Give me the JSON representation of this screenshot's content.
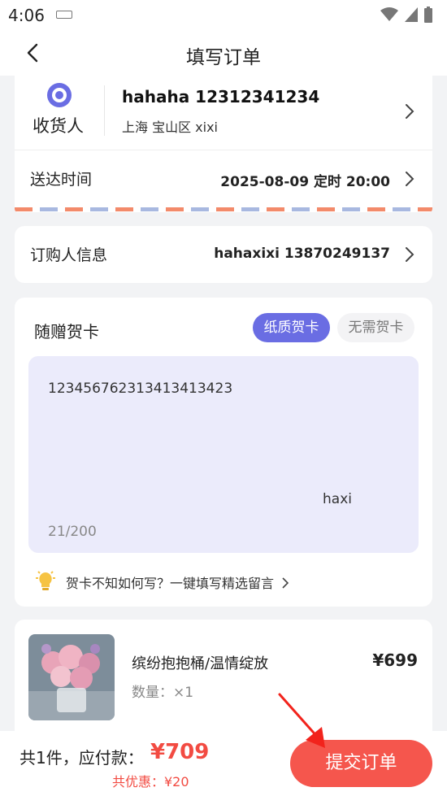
{
  "status_bar": {
    "time": "4:06"
  },
  "nav": {
    "title": "填写订单"
  },
  "address": {
    "label": "收货人",
    "name_phone": "hahaha 12312341234",
    "detail": "上海 宝山区 xixi"
  },
  "delivery": {
    "label": "送达时间",
    "value": "2025-08-09  定时  20:00"
  },
  "buyer": {
    "label": "订购人信息",
    "value": "hahaxixi  13870249137"
  },
  "greeting_card": {
    "title": "随赠贺卡",
    "option_selected": "纸质贺卡",
    "option_other": "无需贺卡",
    "message": "12345676231341341342​3",
    "signature": "haxi",
    "count": "21/200",
    "tip": "贺卡不知如何写？一键填写精选留言"
  },
  "product": {
    "name": "缤纷抱抱桶/温情绽放",
    "quantity": "数量：×1",
    "price": "¥699"
  },
  "bottom": {
    "total_label": "共1件，应付款：",
    "total_value": "¥709",
    "discount": "共优惠：¥20",
    "submit_label": "提交订单"
  },
  "colors": {
    "accent": "#6a6de3",
    "price_red": "#f24b42",
    "submit_bg": "#f5564d"
  }
}
